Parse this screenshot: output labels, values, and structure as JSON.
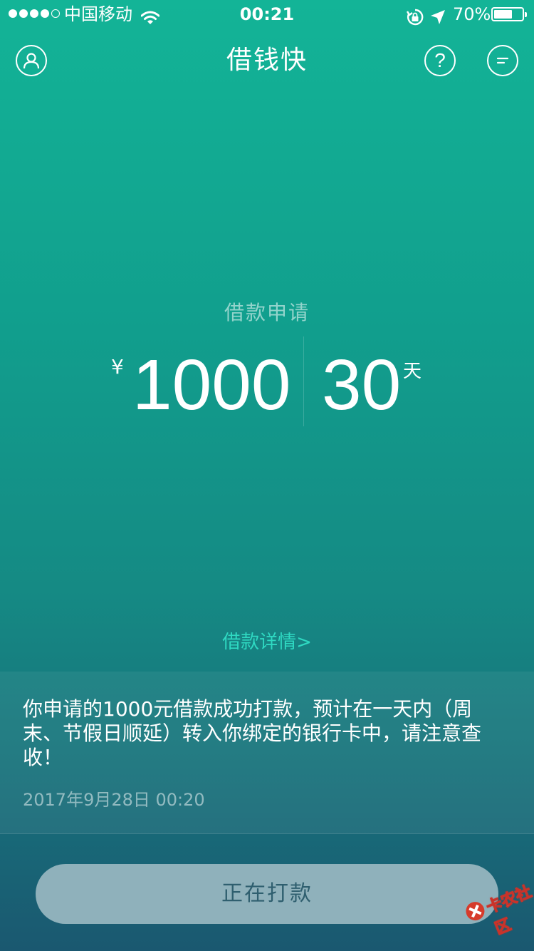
{
  "status_bar": {
    "carrier": "中国移动",
    "time": "00:21",
    "battery_percent": "70%",
    "battery_level": 0.7,
    "signal_bars_filled": 4,
    "signal_bars_total": 5,
    "icons": [
      "wifi-icon",
      "rotation-lock-icon",
      "location-arrow-icon",
      "battery-icon"
    ]
  },
  "nav": {
    "title": "借钱快",
    "left_icon": "user-icon",
    "right_icons": [
      "help-icon",
      "message-menu-icon"
    ]
  },
  "loan": {
    "label": "借款申请",
    "currency": "¥",
    "amount": "1000",
    "days": "30",
    "days_unit": "天"
  },
  "details_link": "借款详情>",
  "message": {
    "text": "你申请的1000元借款成功打款，预计在一天内（周末、节假日顺延）转入你绑定的银行卡中，请注意查收！",
    "time": "2017年9月28日 00:20"
  },
  "action_button": {
    "label": "正在打款"
  },
  "watermark": {
    "text": "卡农社区"
  },
  "colors": {
    "gradient_top": "#13b497",
    "gradient_bottom": "#1a5870",
    "link": "#2fd9c2",
    "button_bg": "#8fb1bb",
    "button_text": "#2f5f6f",
    "watermark_red": "#d63b2b"
  }
}
